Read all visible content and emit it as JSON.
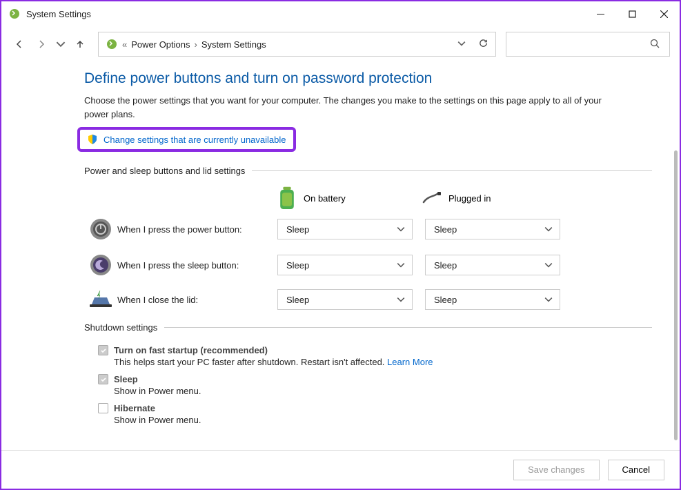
{
  "window": {
    "title": "System Settings"
  },
  "breadcrumb": {
    "prefix": "«",
    "items": [
      "Power Options",
      "System Settings"
    ]
  },
  "page": {
    "title": "Define power buttons and turn on password protection",
    "description": "Choose the power settings that you want for your computer. The changes you make to the settings on this page apply to all of your power plans.",
    "change_link": "Change settings that are currently unavailable"
  },
  "sections": {
    "power_sleep": "Power and sleep buttons and lid settings",
    "shutdown": "Shutdown settings"
  },
  "columns": {
    "battery": "On battery",
    "plugged": "Plugged in"
  },
  "settings": [
    {
      "label": "When I press the power button:",
      "battery": "Sleep",
      "plugged": "Sleep"
    },
    {
      "label": "When I press the sleep button:",
      "battery": "Sleep",
      "plugged": "Sleep"
    },
    {
      "label": "When I close the lid:",
      "battery": "Sleep",
      "plugged": "Sleep"
    }
  ],
  "shutdown": [
    {
      "title": "Turn on fast startup (recommended)",
      "desc_prefix": "This helps start your PC faster after shutdown. Restart isn't affected. ",
      "learn_more": "Learn More",
      "checked": true
    },
    {
      "title": "Sleep",
      "desc": "Show in Power menu.",
      "checked": true
    },
    {
      "title": "Hibernate",
      "desc": "Show in Power menu.",
      "checked": false
    }
  ],
  "buttons": {
    "save": "Save changes",
    "cancel": "Cancel"
  }
}
